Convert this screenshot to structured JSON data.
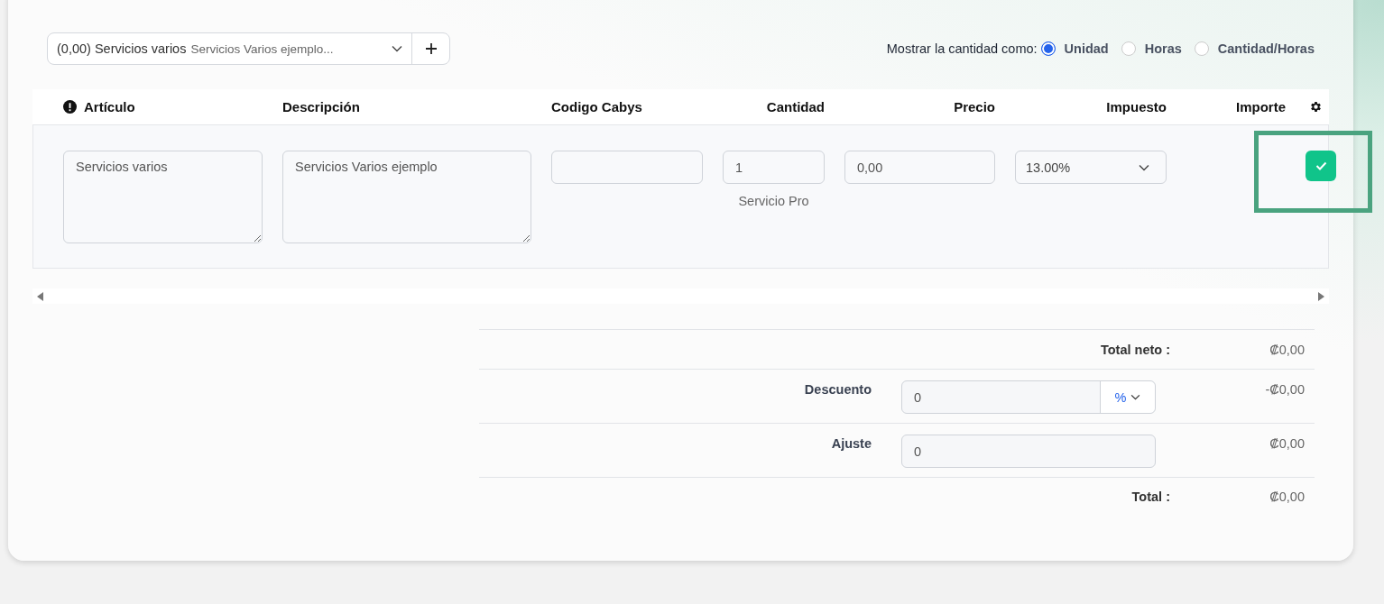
{
  "item_picker": {
    "value": "(0,00) Servicios varios",
    "detail": "Servicios Varios ejemplo..."
  },
  "quantity_mode": {
    "label": "Mostrar la cantidad como:",
    "options": [
      {
        "label": "Unidad",
        "selected": true
      },
      {
        "label": "Horas",
        "selected": false
      },
      {
        "label": "Cantidad/Horas",
        "selected": false
      }
    ]
  },
  "table": {
    "columns": [
      {
        "label": "Artículo",
        "required": true
      },
      {
        "label": "Descripción",
        "required": false
      },
      {
        "label": "Codigo Cabys",
        "required": false
      },
      {
        "label": "Cantidad",
        "required": false
      },
      {
        "label": "Precio",
        "required": false
      },
      {
        "label": "Impuesto",
        "required": false
      },
      {
        "label": "Importe",
        "required": false
      }
    ],
    "rows": [
      {
        "articulo": "Servicios varios",
        "descripcion": "Servicios Varios ejemplo",
        "cantidad": "1",
        "unit": "Servicio Pro",
        "precio": "0,00",
        "impuesto": "13.00%",
        "confirmed": true,
        "highlighted": true
      }
    ]
  },
  "totals": [
    {
      "kind": "sum",
      "label": "Total neto :",
      "amount": "₡0,00"
    },
    {
      "kind": "discount",
      "label": "Descuento",
      "value": "0",
      "unit": "%",
      "amount": "-₡0,00"
    },
    {
      "kind": "adjust",
      "label": "Ajuste",
      "value": "0",
      "amount": "₡0,00"
    },
    {
      "kind": "sum",
      "label": "Total :",
      "amount": "₡0,00"
    }
  ]
}
